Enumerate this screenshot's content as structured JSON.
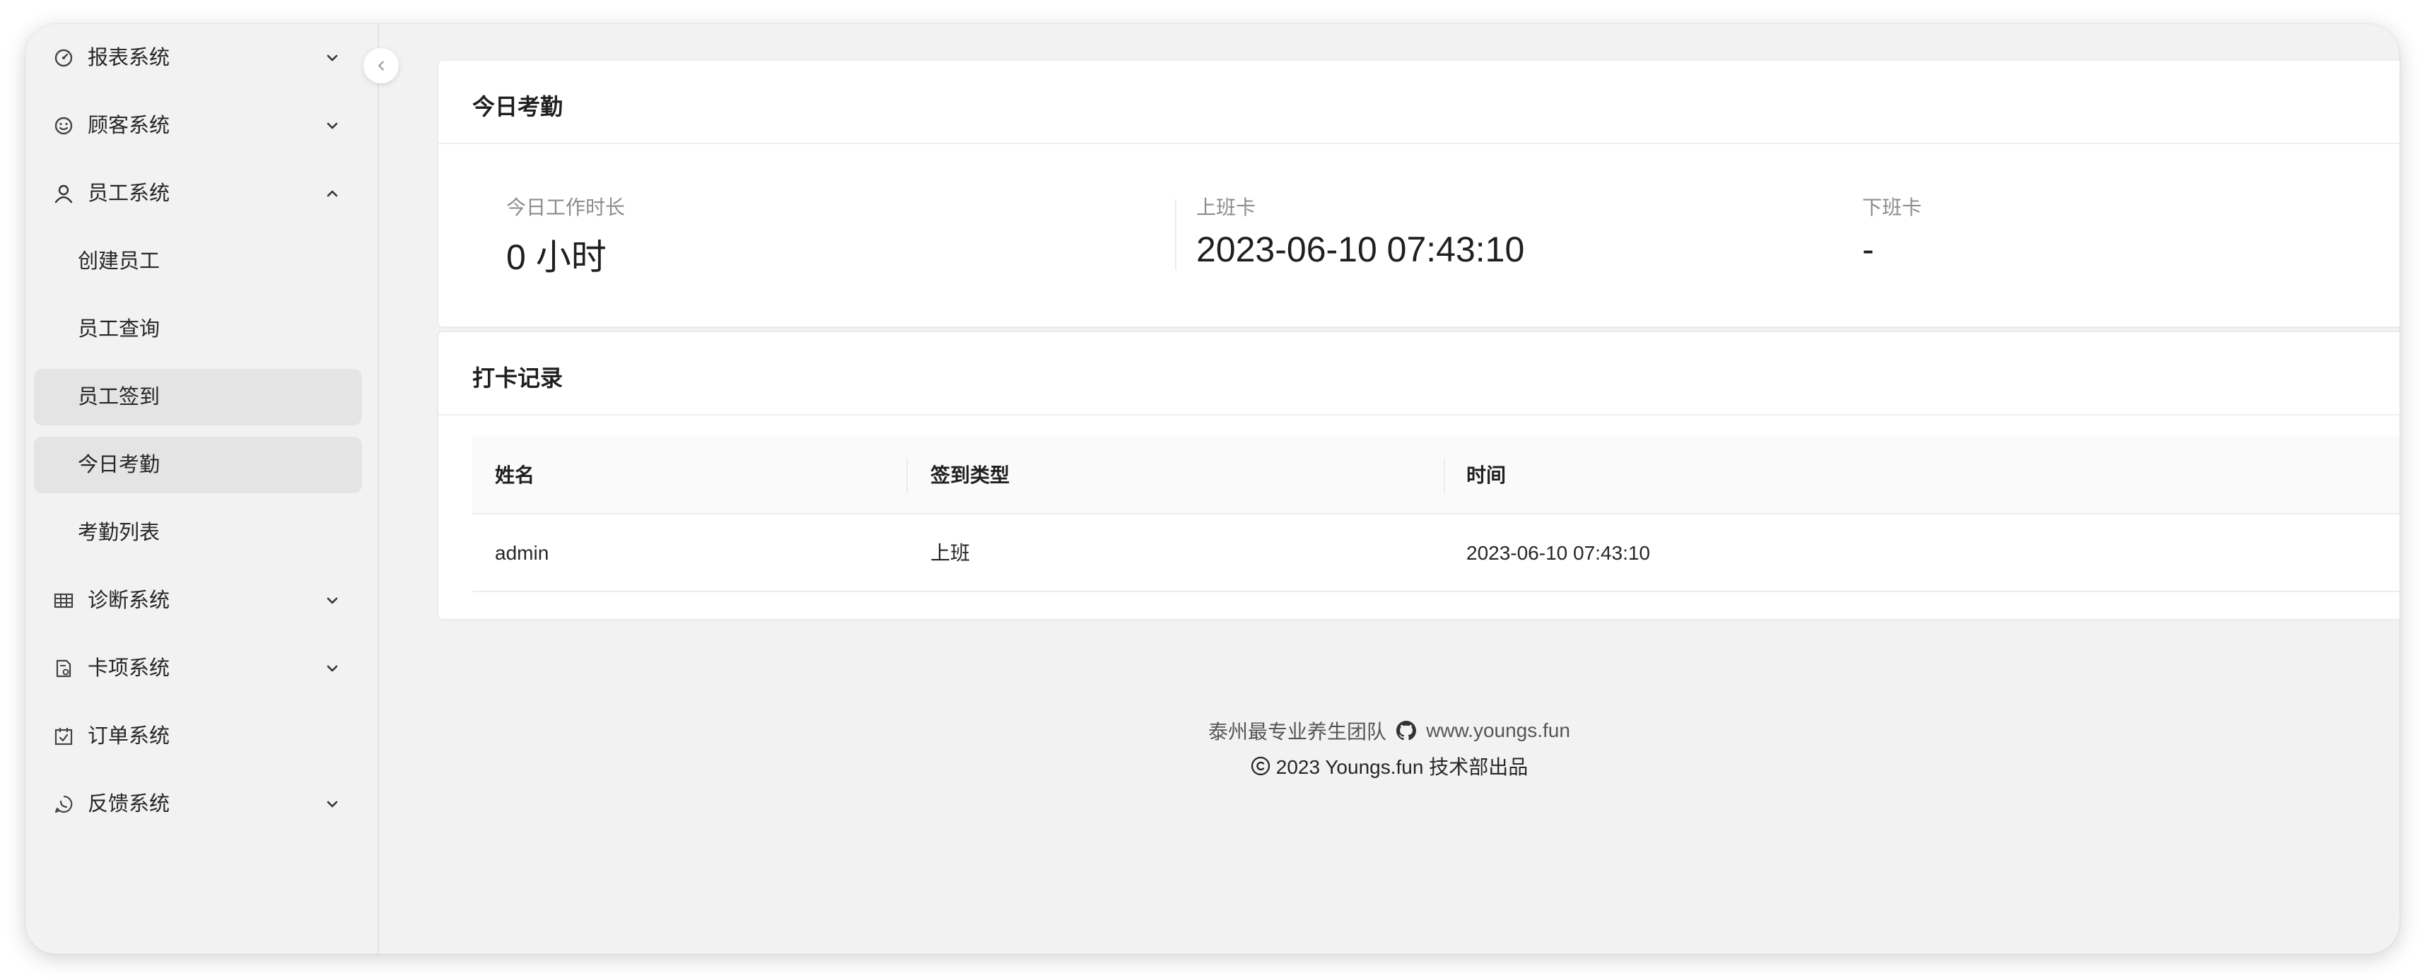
{
  "sidebar": {
    "items": [
      {
        "label": "报表系统",
        "icon": "dashboard-icon",
        "expandable": true
      },
      {
        "label": "顾客系统",
        "icon": "smile-icon",
        "expandable": true
      },
      {
        "label": "员工系统",
        "icon": "user-icon",
        "expandable": true,
        "expanded": true
      },
      {
        "label": "诊断系统",
        "icon": "table-icon",
        "expandable": true
      },
      {
        "label": "卡项系统",
        "icon": "card-icon",
        "expandable": true
      },
      {
        "label": "订单系统",
        "icon": "calendar-icon",
        "expandable": false
      },
      {
        "label": "反馈系统",
        "icon": "whatsapp-icon",
        "expandable": true
      }
    ],
    "employee_sub": [
      {
        "label": "创建员工",
        "active": false
      },
      {
        "label": "员工查询",
        "active": false
      },
      {
        "label": "员工签到",
        "active": true
      },
      {
        "label": "今日考勤",
        "active": true
      },
      {
        "label": "考勤列表",
        "active": false
      }
    ]
  },
  "attendance": {
    "title": "今日考勤",
    "work_hours_label": "今日工作时长",
    "work_hours_value": "0 小时",
    "clock_in_label": "上班卡",
    "clock_in_value": "2023-06-10 07:43:10",
    "clock_out_label": "下班卡",
    "clock_out_value": "-"
  },
  "records": {
    "title": "打卡记录",
    "columns": [
      "姓名",
      "签到类型",
      "时间"
    ],
    "rows": [
      {
        "name": "admin",
        "type": "上班",
        "time": "2023-06-10 07:43:10"
      }
    ]
  },
  "footer": {
    "team": "泰州最专业养生团队",
    "site": "www.youngs.fun",
    "copyright": "2023 Youngs.fun 技术部出品",
    "github_icon": "github-icon",
    "copyright_icon": "copyright-icon"
  }
}
